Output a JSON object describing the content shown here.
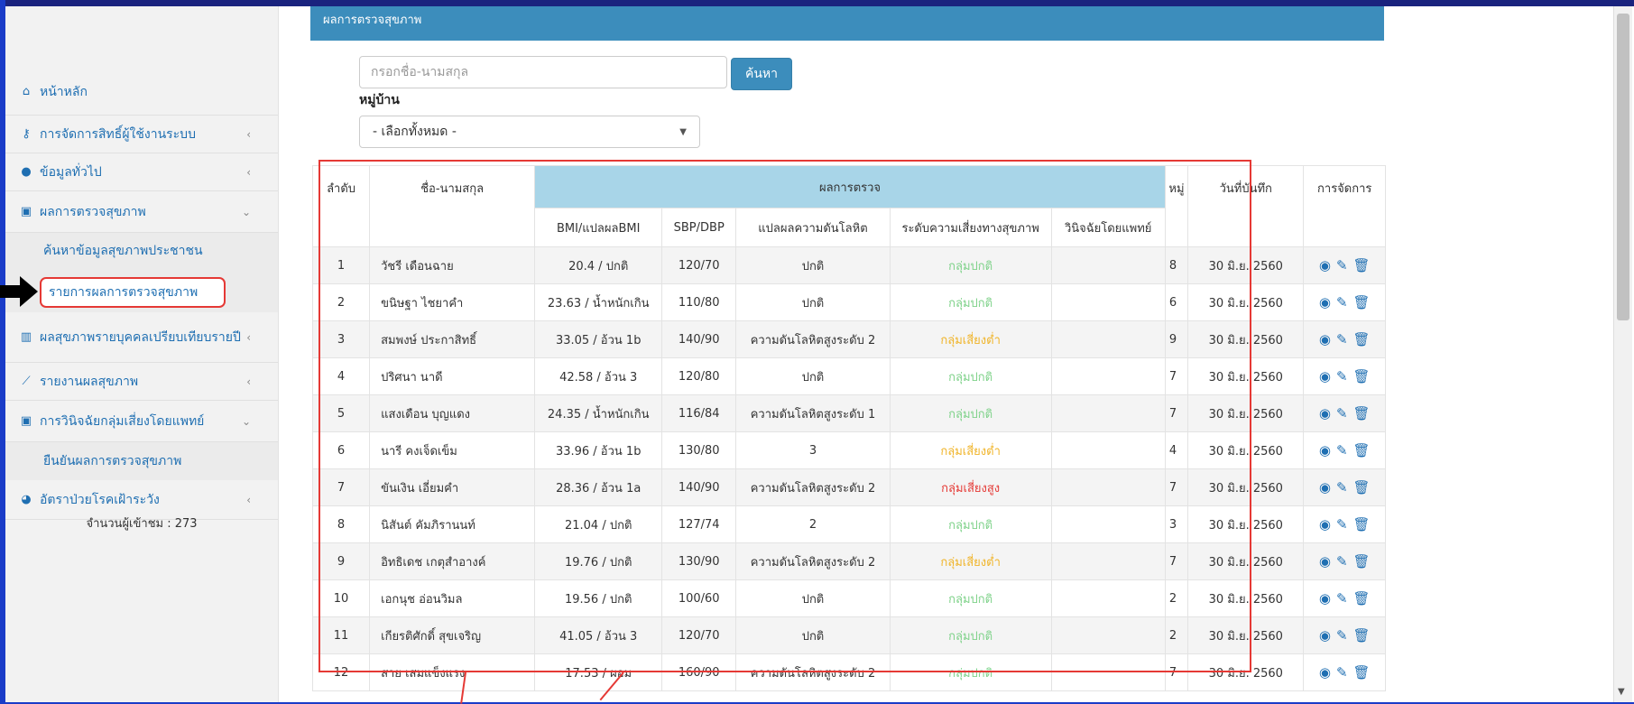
{
  "panel": {
    "title": "ผลการตรวจสุขภาพ"
  },
  "sidebar": {
    "items": [
      {
        "label": "หน้าหลัก",
        "icon": "home-icon"
      },
      {
        "label": "การจัดการสิทธิ์ผู้ใช้งานระบบ",
        "icon": "key-icon"
      },
      {
        "label": "ข้อมูลทั่วไป",
        "icon": "user-icon"
      },
      {
        "label": "ผลการตรวจสุขภาพ",
        "icon": "medkit-icon"
      },
      {
        "label": "ค้นหาข้อมูลสุขภาพประชาชน"
      },
      {
        "label": "รายการผลการตรวจสุขภาพ"
      },
      {
        "label": "ผลสุขภาพรายบุคคลเปรียบเทียบรายปี",
        "icon": "bar-chart-icon"
      },
      {
        "label": "รายงานผลสุขภาพ",
        "icon": "line-chart-icon"
      },
      {
        "label": "การวินิจฉัยกลุ่มเสี่ยงโดยแพทย์",
        "icon": "medkit-icon"
      },
      {
        "label": "ยืนยันผลการตรวจสุขภาพ"
      },
      {
        "label": "อัตราป่วยโรคเฝ้าระวัง",
        "icon": "pie-chart-icon"
      }
    ],
    "visitors": "จำนวนผู้เข้าชม : 273"
  },
  "search": {
    "placeholder": "กรอกชื่อ-นามสกุล",
    "button": "ค้นหา"
  },
  "village": {
    "label": "หมู่บ้าน",
    "selected": "- เลือกทั้งหมด -"
  },
  "table": {
    "headers": {
      "no": "ลำดับ",
      "name": "ชื่อ-นามสกุล",
      "result_group": "ผลการตรวจ",
      "bmi": "BMI/แปลผลBMI",
      "bp": "SBP/DBP",
      "bp_result": "แปลผลความดันโลหิต",
      "risk": "ระดับความเสี่ยงทางสุขภาพ",
      "doctor": "วินิจฉัยโดยแพทย์",
      "moo": "หมู่",
      "date": "วันที่บันทึก",
      "manage": "การจัดการ"
    },
    "rows": [
      {
        "no": "1",
        "name": "วัชรี เดือนฉาย",
        "bmi": "20.4 / ปกติ",
        "bp": "120/70",
        "bp_result": "ปกติ",
        "risk": "กลุ่มปกติ",
        "risk_level": "ok",
        "doctor": "",
        "moo": "8",
        "date": "30 มิ.ย. 2560"
      },
      {
        "no": "2",
        "name": "ขนิษฐา ไชยาคำ",
        "bmi": "23.63 / น้ำหนักเกิน",
        "bp": "110/80",
        "bp_result": "ปกติ",
        "risk": "กลุ่มปกติ",
        "risk_level": "ok",
        "doctor": "",
        "moo": "6",
        "date": "30 มิ.ย. 2560"
      },
      {
        "no": "3",
        "name": "สมพงษ์ ประกาสิทธิ์",
        "bmi": "33.05 / อ้วน 1b",
        "bp": "140/90",
        "bp_result": "ความดันโลหิตสูงระดับ 2",
        "risk": "กลุ่มเสี่ยงต่ำ",
        "risk_level": "low",
        "doctor": "",
        "moo": "9",
        "date": "30 มิ.ย. 2560"
      },
      {
        "no": "4",
        "name": "ปริศนา นาดี",
        "bmi": "42.58 / อ้วน 3",
        "bp": "120/80",
        "bp_result": "ปกติ",
        "risk": "กลุ่มปกติ",
        "risk_level": "ok",
        "doctor": "",
        "moo": "7",
        "date": "30 มิ.ย. 2560"
      },
      {
        "no": "5",
        "name": "แสงเดือน บุญแดง",
        "bmi": "24.35 / น้ำหนักเกิน",
        "bp": "116/84",
        "bp_result": "ความดันโลหิตสูงระดับ 1",
        "risk": "กลุ่มปกติ",
        "risk_level": "ok",
        "doctor": "",
        "moo": "7",
        "date": "30 มิ.ย. 2560"
      },
      {
        "no": "6",
        "name": "นารี คงเจ็ดเข็ม",
        "bmi": "33.96 / อ้วน 1b",
        "bp": "130/80",
        "bp_result": "3",
        "risk": "กลุ่มเสี่ยงต่ำ",
        "risk_level": "low",
        "doctor": "",
        "moo": "4",
        "date": "30 มิ.ย. 2560"
      },
      {
        "no": "7",
        "name": "ขันเงิน เอี่ยมคำ",
        "bmi": "28.36 / อ้วน 1a",
        "bp": "140/90",
        "bp_result": "ความดันโลหิตสูงระดับ 2",
        "risk": "กลุ่มเสี่ยงสูง",
        "risk_level": "high",
        "doctor": "",
        "moo": "7",
        "date": "30 มิ.ย. 2560"
      },
      {
        "no": "8",
        "name": "นิสันต์ คัมภิรานนท์",
        "bmi": "21.04 / ปกติ",
        "bp": "127/74",
        "bp_result": "2",
        "risk": "กลุ่มปกติ",
        "risk_level": "ok",
        "doctor": "",
        "moo": "3",
        "date": "30 มิ.ย. 2560"
      },
      {
        "no": "9",
        "name": "อิทธิเดช เกตุสำอางค์",
        "bmi": "19.76 / ปกติ",
        "bp": "130/90",
        "bp_result": "ความดันโลหิตสูงระดับ 2",
        "risk": "กลุ่มเสี่ยงต่ำ",
        "risk_level": "low",
        "doctor": "",
        "moo": "7",
        "date": "30 มิ.ย. 2560"
      },
      {
        "no": "10",
        "name": "เอกนุช อ่อนวิมล",
        "bmi": "19.56 / ปกติ",
        "bp": "100/60",
        "bp_result": "ปกติ",
        "risk": "กลุ่มปกติ",
        "risk_level": "ok",
        "doctor": "",
        "moo": "2",
        "date": "30 มิ.ย. 2560"
      },
      {
        "no": "11",
        "name": "เกียรติศักดิ์ สุขเจริญ",
        "bmi": "41.05 / อ้วน 3",
        "bp": "120/70",
        "bp_result": "ปกติ",
        "risk": "กลุ่มปกติ",
        "risk_level": "ok",
        "doctor": "",
        "moo": "2",
        "date": "30 มิ.ย. 2560"
      },
      {
        "no": "12",
        "name": "สาย เสมแข็งแรง",
        "bmi": "17.53 / ผอม",
        "bp": "160/90",
        "bp_result": "ความดันโลหิตสูงระดับ 2",
        "risk": "กลุ่มปกติ",
        "risk_level": "ok",
        "doctor": "",
        "moo": "7",
        "date": "30 มิ.ย. 2560"
      }
    ]
  },
  "colors": {
    "header_blue": "#3c8dbc",
    "risk_normal": "#7fd28a",
    "risk_low": "#f0b429",
    "risk_high": "#e53935",
    "group_header": "#a8d5e8"
  }
}
